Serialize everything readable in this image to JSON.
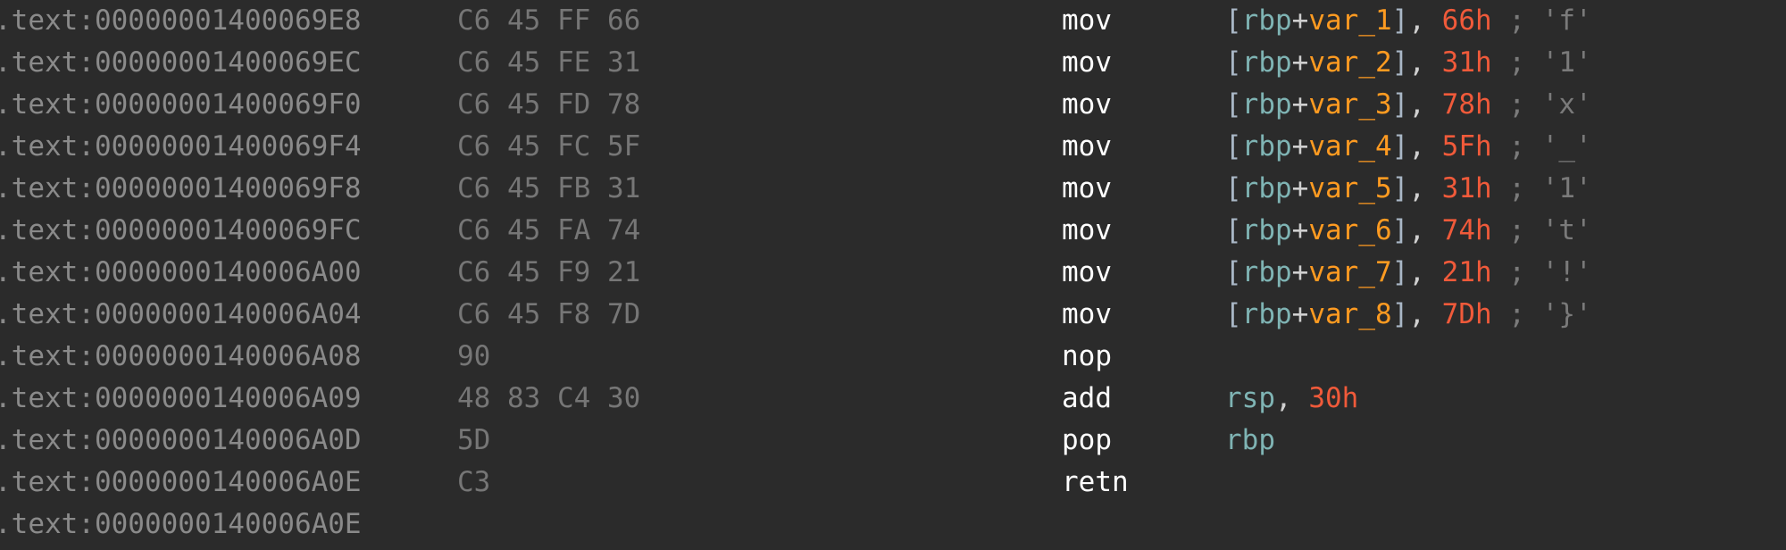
{
  "colors": {
    "background": "#2b2b2b",
    "address": "#8a8a8a",
    "bytes": "#767676",
    "mnemonic": "#ffffff",
    "register": "#7fb4b4",
    "variable": "#ff9b21",
    "immediate": "#f05a3a",
    "comment": "#7a7a7a"
  },
  "lines": [
    {
      "prefix": ".text:00000001400069E8",
      "bytes": "C6 45 FF 66",
      "mnemonic": "mov",
      "kind": "mem",
      "reg": "rbp",
      "var": "var_1",
      "imm": "66h",
      "comment": "; 'f'"
    },
    {
      "prefix": ".text:00000001400069EC",
      "bytes": "C6 45 FE 31",
      "mnemonic": "mov",
      "kind": "mem",
      "reg": "rbp",
      "var": "var_2",
      "imm": "31h",
      "comment": "; '1'"
    },
    {
      "prefix": ".text:00000001400069F0",
      "bytes": "C6 45 FD 78",
      "mnemonic": "mov",
      "kind": "mem",
      "reg": "rbp",
      "var": "var_3",
      "imm": "78h",
      "comment": "; 'x'"
    },
    {
      "prefix": ".text:00000001400069F4",
      "bytes": "C6 45 FC 5F",
      "mnemonic": "mov",
      "kind": "mem",
      "reg": "rbp",
      "var": "var_4",
      "imm": "5Fh",
      "comment": "; '_'"
    },
    {
      "prefix": ".text:00000001400069F8",
      "bytes": "C6 45 FB 31",
      "mnemonic": "mov",
      "kind": "mem",
      "reg": "rbp",
      "var": "var_5",
      "imm": "31h",
      "comment": "; '1'"
    },
    {
      "prefix": ".text:00000001400069FC",
      "bytes": "C6 45 FA 74",
      "mnemonic": "mov",
      "kind": "mem",
      "reg": "rbp",
      "var": "var_6",
      "imm": "74h",
      "comment": "; 't'"
    },
    {
      "prefix": ".text:0000000140006A00",
      "bytes": "C6 45 F9 21",
      "mnemonic": "mov",
      "kind": "mem",
      "reg": "rbp",
      "var": "var_7",
      "imm": "21h",
      "comment": "; '!'"
    },
    {
      "prefix": ".text:0000000140006A04",
      "bytes": "C6 45 F8 7D",
      "mnemonic": "mov",
      "kind": "mem",
      "reg": "rbp",
      "var": "var_8",
      "imm": "7Dh",
      "comment": "; '}'"
    },
    {
      "prefix": ".text:0000000140006A08",
      "bytes": "90",
      "mnemonic": "nop",
      "kind": "none"
    },
    {
      "prefix": ".text:0000000140006A09",
      "bytes": "48 83 C4 30",
      "mnemonic": "add",
      "kind": "regimm",
      "reg": "rsp",
      "imm": "30h"
    },
    {
      "prefix": ".text:0000000140006A0D",
      "bytes": "5D",
      "mnemonic": "pop",
      "kind": "reg",
      "reg": "rbp"
    },
    {
      "prefix": ".text:0000000140006A0E",
      "bytes": "C3",
      "mnemonic": "retn",
      "kind": "none"
    },
    {
      "prefix": ".text:0000000140006A0E",
      "bytes": "",
      "mnemonic": "",
      "kind": "none"
    }
  ]
}
